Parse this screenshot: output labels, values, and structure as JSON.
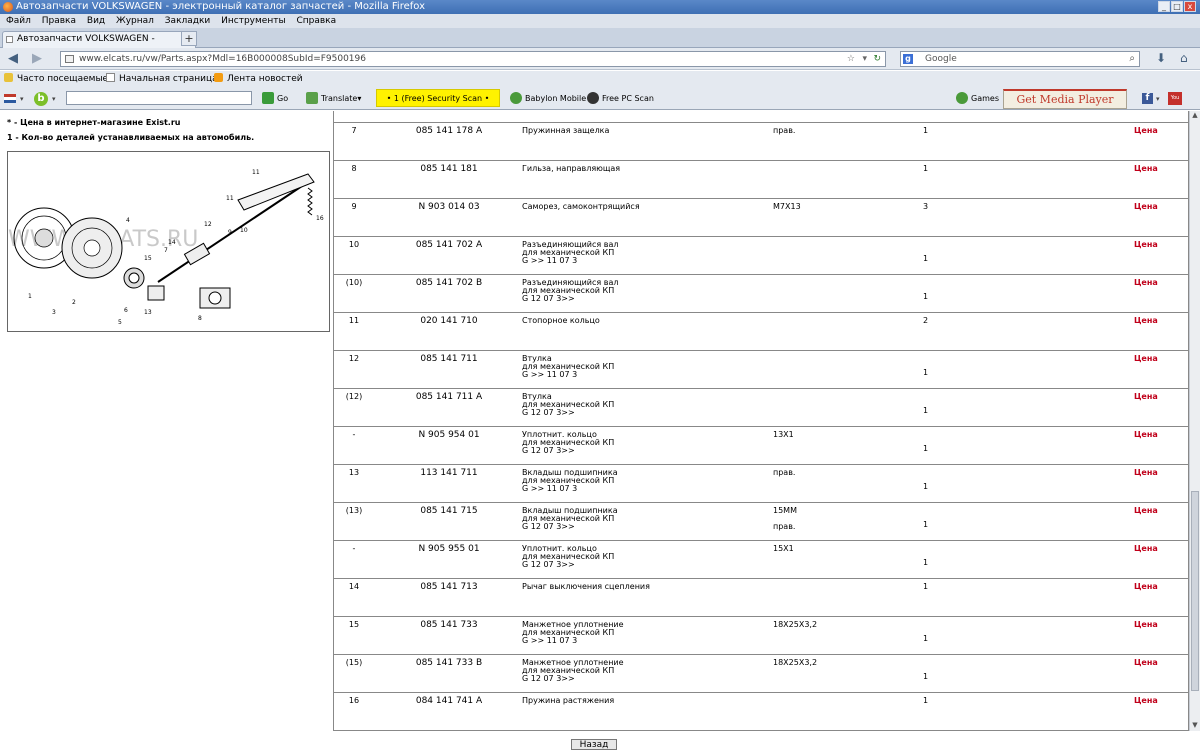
{
  "window": {
    "title": "Автозапчасти VOLKSWAGEN - электронный каталог запчастей - Mozilla Firefox"
  },
  "menu": [
    "Файл",
    "Правка",
    "Вид",
    "Журнал",
    "Закладки",
    "Инструменты",
    "Справка"
  ],
  "tab": {
    "label": "Автозапчасти VOLKSWAGEN - электронны..."
  },
  "nav": {
    "url": "www.elcats.ru/vw/Parts.aspx?Mdl=16B000008SubId=F9500196",
    "search_placeholder": "Google"
  },
  "bookmarks": [
    "Часто посещаемые",
    "Начальная страница",
    "Лента новостей"
  ],
  "toolbar": {
    "go": "Go",
    "translate": "Translate",
    "security_scan": "• 1 (Free) Security Scan •",
    "babylon": "Babylon Mobile",
    "free_pc_scan": "Free PC Scan",
    "games": "Games",
    "media_plugin": "Get Media Player Plugin"
  },
  "left": {
    "note1_mark": "*",
    "note1": " - Цена в интернет-магазине Exist.ru",
    "note2_mark": "1",
    "note2": " - Кол-во деталей устанавливаемых на автомобиль."
  },
  "diagram": {
    "watermark": "WWW.ELCATS.RU",
    "callouts": [
      "1",
      "2",
      "3",
      "4",
      "5",
      "6",
      "7",
      "8",
      "9",
      "10",
      "11",
      "11",
      "12",
      "13",
      "14",
      "15",
      "16"
    ]
  },
  "parts": [
    {
      "pos": "7",
      "num": "085 141 178 A",
      "name": "Пружинная защелка",
      "note": "прав.",
      "qty": "1",
      "price": "Цена"
    },
    {
      "pos": "8",
      "num": "085 141 181",
      "name": "Гильза, направляющая",
      "note": "",
      "qty": "1",
      "price": "Цена"
    },
    {
      "pos": "9",
      "num": "N 903 014 03",
      "name": "Саморез, самоконтрящийся",
      "note": "M7X13",
      "qty": "3",
      "price": "Цена"
    },
    {
      "pos": "10",
      "num": "085 141 702 A",
      "name": "Разъединяющийся вал\nдля механической КП\nG >> 11 07 3",
      "note": "",
      "qty": "1",
      "qty_low": true,
      "price": "Цена"
    },
    {
      "pos": "(10)",
      "num": "085 141 702 B",
      "name": "Разъединяющийся вал\nдля механической КП\nG 12 07 3>>",
      "note": "",
      "qty": "1",
      "qty_low": true,
      "price": "Цена"
    },
    {
      "pos": "11",
      "num": "020 141 710",
      "name": "Стопорное кольцо",
      "note": "",
      "qty": "2",
      "price": "Цена"
    },
    {
      "pos": "12",
      "num": "085 141 711",
      "name": "Втулка\nдля механической КП\nG >> 11 07 3",
      "note": "",
      "qty": "1",
      "qty_low": true,
      "price": "Цена"
    },
    {
      "pos": "(12)",
      "num": "085 141 711 A",
      "name": "Втулка\nдля механической КП\nG 12 07 3>>",
      "note": "",
      "qty": "1",
      "qty_low": true,
      "price": "Цена"
    },
    {
      "pos": "-",
      "num": "N 905 954 01",
      "name": "Уплотнит. кольцо\nдля механической КП\nG 12 07 3>>",
      "note": "13X1",
      "qty": "1",
      "qty_low": true,
      "price": "Цена"
    },
    {
      "pos": "13",
      "num": "113 141 711",
      "name": "Вкладыш подшипника\nдля механической КП\nG >> 11 07 3",
      "note": "прав.",
      "qty": "1",
      "qty_low": true,
      "price": "Цена"
    },
    {
      "pos": "(13)",
      "num": "085 141 715",
      "name": "Вкладыш подшипника\nдля механической КП\nG 12 07 3>>",
      "note": "15MM\n\nправ.",
      "qty": "1",
      "qty_low": true,
      "price": "Цена"
    },
    {
      "pos": "-",
      "num": "N 905 955 01",
      "name": "Уплотнит. кольцо\nдля механической КП\nG 12 07 3>>",
      "note": "15X1",
      "qty": "1",
      "qty_low": true,
      "price": "Цена"
    },
    {
      "pos": "14",
      "num": "085 141 713",
      "name": "Рычаг выключения сцепления",
      "note": "",
      "qty": "1",
      "price": "Цена"
    },
    {
      "pos": "15",
      "num": "085 141 733",
      "name": "Манжетное уплотнение\nдля механической КП\nG >> 11 07 3",
      "note": "18X25X3,2",
      "qty": "1",
      "qty_low": true,
      "price": "Цена"
    },
    {
      "pos": "(15)",
      "num": "085 141 733 B",
      "name": "Манжетное уплотнение\nдля механической КП\nG 12 07 3>>",
      "note": "18X25X3,2",
      "qty": "1",
      "qty_low": true,
      "price": "Цена"
    },
    {
      "pos": "16",
      "num": "084 141 741 A",
      "name": "Пружина растяжения",
      "note": "",
      "qty": "1",
      "price": "Цена"
    }
  ],
  "back_button": "Назад"
}
